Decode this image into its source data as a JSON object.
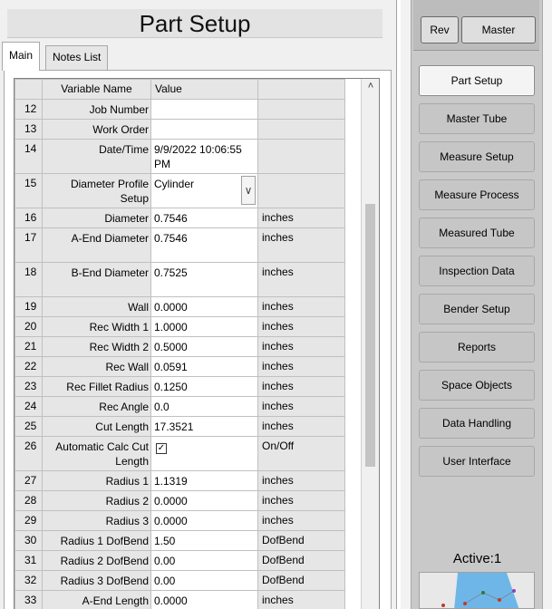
{
  "page_title": "Part Setup",
  "tabs": [
    {
      "label": "Main"
    },
    {
      "label": "Notes List"
    }
  ],
  "grid": {
    "headers": {
      "variable": "Variable Name",
      "value": "Value"
    },
    "rows": [
      {
        "num": "12",
        "name": "Job Number",
        "value": "",
        "unit": ""
      },
      {
        "num": "13",
        "name": "Work Order",
        "value": "",
        "unit": ""
      },
      {
        "num": "14",
        "name": "Date/Time",
        "value": "9/9/2022 10:06:55 PM",
        "unit": ""
      },
      {
        "num": "15",
        "name": "Diameter Profile Setup",
        "value": "Cylinder",
        "unit": ""
      },
      {
        "num": "16",
        "name": "Diameter",
        "value": "0.7546",
        "unit": "inches"
      },
      {
        "num": "17",
        "name": "A-End Diameter",
        "value": "0.7546",
        "unit": "inches"
      },
      {
        "num": "18",
        "name": "B-End Diameter",
        "value": "0.7525",
        "unit": "inches"
      },
      {
        "num": "19",
        "name": "Wall",
        "value": "0.0000",
        "unit": "inches"
      },
      {
        "num": "20",
        "name": "Rec Width 1",
        "value": "1.0000",
        "unit": "inches"
      },
      {
        "num": "21",
        "name": "Rec Width 2",
        "value": "0.5000",
        "unit": "inches"
      },
      {
        "num": "22",
        "name": "Rec Wall",
        "value": "0.0591",
        "unit": "inches"
      },
      {
        "num": "23",
        "name": "Rec Fillet Radius",
        "value": "0.1250",
        "unit": "inches"
      },
      {
        "num": "24",
        "name": "Rec Angle",
        "value": "0.0",
        "unit": "inches"
      },
      {
        "num": "25",
        "name": "Cut Length",
        "value": "17.3521",
        "unit": "inches"
      },
      {
        "num": "26",
        "name": "Automatic Calc Cut Length",
        "value": "✓",
        "unit": "On/Off"
      },
      {
        "num": "27",
        "name": "Radius 1",
        "value": "1.1319",
        "unit": "inches"
      },
      {
        "num": "28",
        "name": "Radius 2",
        "value": "0.0000",
        "unit": "inches"
      },
      {
        "num": "29",
        "name": "Radius 3",
        "value": "0.0000",
        "unit": "inches"
      },
      {
        "num": "30",
        "name": "Radius 1 DofBend",
        "value": "1.50",
        "unit": "DofBend"
      },
      {
        "num": "31",
        "name": "Radius 2 DofBend",
        "value": "0.00",
        "unit": "DofBend"
      },
      {
        "num": "32",
        "name": "Radius 3 DofBend",
        "value": "0.00",
        "unit": "DofBend"
      },
      {
        "num": "33",
        "name": "A-End Length",
        "value": "0.0000",
        "unit": "inches"
      }
    ]
  },
  "toolbar": {
    "rev_label": "Rev",
    "master_label": "Master"
  },
  "nav": [
    {
      "label": "Part Setup",
      "active": true
    },
    {
      "label": "Master Tube"
    },
    {
      "label": "Measure Setup"
    },
    {
      "label": "Measure Process"
    },
    {
      "label": "Measured Tube"
    },
    {
      "label": "Inspection Data"
    },
    {
      "label": "Bender Setup"
    },
    {
      "label": "Reports"
    },
    {
      "label": "Space Objects"
    },
    {
      "label": "Data Handling"
    },
    {
      "label": "User Interface"
    }
  ],
  "active_label": "Active:1",
  "icons": {
    "scroll_up": "chevron-up-icon",
    "dropdown": "chevron-down-icon",
    "checkbox": "checkbox-checked-icon"
  }
}
